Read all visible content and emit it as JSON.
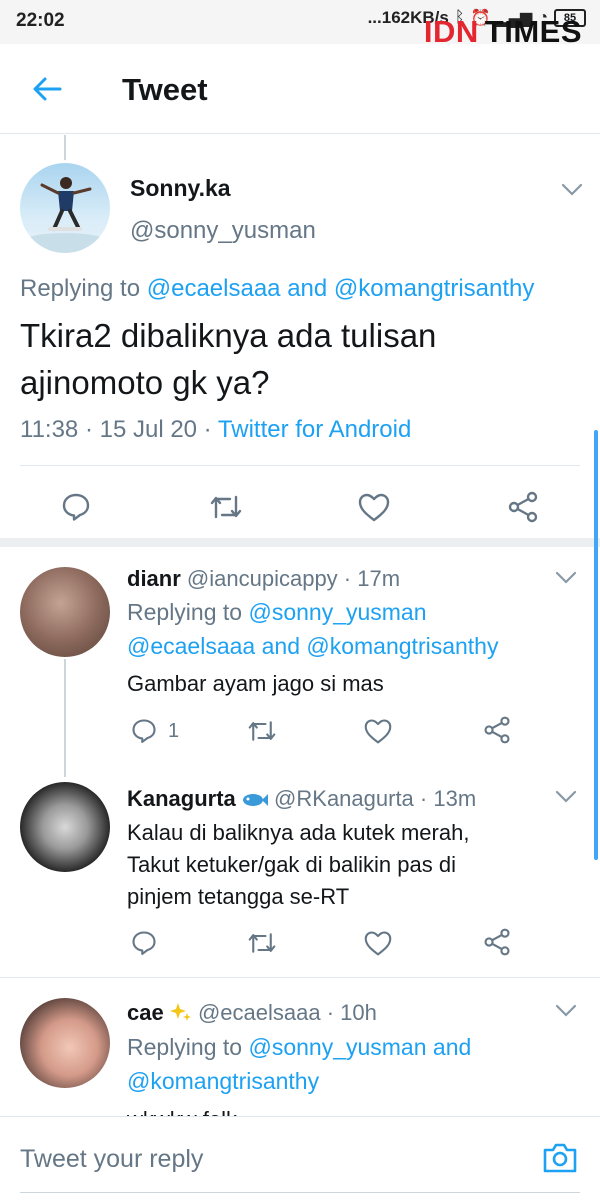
{
  "status_bar": {
    "time": "22:02",
    "net_speed": "...162KB/s",
    "battery": "85"
  },
  "watermark": {
    "part1": "IDN",
    "part2": "TIMES"
  },
  "header": {
    "title": "Tweet"
  },
  "main_tweet": {
    "name": "Sonny.ka",
    "handle": "@sonny_yusman",
    "replying_prefix": "Replying to",
    "mention1": "@ecaelsaaa",
    "and": "and",
    "mention2": "@komangtrisanthy",
    "text": "Tkira2 dibaliknya ada tulisan ajinomoto gk ya?",
    "time": "11:38 · 15 Jul 20 · ",
    "source": "Twitter for Android"
  },
  "replies": [
    {
      "name": "dianr",
      "handle": "@iancupicappy · 17m",
      "replying_prefix": "Replying to",
      "mention1": "@sonny_yusman",
      "mention2": "@ecaelsaaa",
      "and": "and",
      "mention3": "@komangtrisanthy",
      "text": "Gambar ayam jago si mas",
      "reply_count": "1"
    },
    {
      "name": "Kanagurta",
      "handle": "@RKanagurta · 13m",
      "text_line1": "Kalau di baliknya ada kutek merah,",
      "text_line2": "Takut ketuker/gak di balikin pas di",
      "text_line3": "pinjem tetangga se-RT"
    },
    {
      "name": "cae",
      "handle": "@ecaelsaaa · 10h",
      "replying_prefix": "Replying to",
      "mention1": "@sonny_yusman",
      "and": "and",
      "mention2": "@komangtrisanthy",
      "text_cut": "wkwkw folk"
    }
  ],
  "compose": {
    "placeholder": "Tweet your reply"
  },
  "colors": {
    "accent": "#1da1f2",
    "secondary_text": "#657786",
    "divider": "#e1e8ed",
    "watermark_red": "#e3262f"
  }
}
